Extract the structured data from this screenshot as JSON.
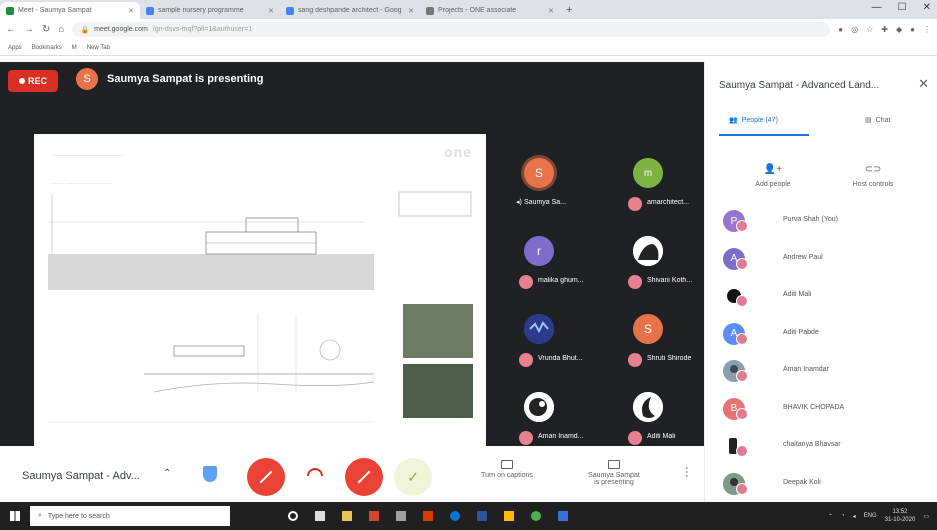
{
  "browser": {
    "tabs": [
      {
        "label": "Meet - Saumya Sampat",
        "active": true
      },
      {
        "label": "sample nursery programme",
        "active": false
      },
      {
        "label": "sang deshpande architect - Goog",
        "active": false
      },
      {
        "label": "Projects - ONE associate",
        "active": false
      }
    ],
    "new_tab_glyph": "+",
    "url_main": "meet.google.com",
    "url_rest": "/gn-dsvs-mqf?pli=1&authuser=1",
    "bookmarks": [
      "Apps",
      "Bookmarks",
      "M",
      "New Tab"
    ]
  },
  "meeting": {
    "rec_label": "REC",
    "presenter_initial": "S",
    "presenting_banner": "Saumya Sampat is presenting",
    "slide_logo": "one",
    "tiles": [
      {
        "name": "Saumya Sa...",
        "initial": "S",
        "color": "#e8734a",
        "speaking": true
      },
      {
        "name": "amarchitect...",
        "initial": "m",
        "color": "#7cb342",
        "speaking": false
      },
      {
        "name": "malika ghum...",
        "initial": "r",
        "color": "#7e6ccc",
        "speaking": false
      },
      {
        "name": "Shivani Koth...",
        "initial": "",
        "color": "#cfcfcf",
        "speaking": false
      },
      {
        "name": "Vrunda Bhut...",
        "initial": "",
        "color": "#3f51b5",
        "speaking": false
      },
      {
        "name": "Shruti Shirode",
        "initial": "S",
        "color": "#e8734a",
        "speaking": false
      },
      {
        "name": "Aman Inamd...",
        "initial": "",
        "color": "#cfcfcf",
        "speaking": false
      },
      {
        "name": "Aditi Mali",
        "initial": "",
        "color": "#cfcfcf",
        "speaking": false
      }
    ],
    "bar": {
      "meeting_title": "Saumya Sampat - Adv...",
      "captions_label": "Turn on captions",
      "presenting_label_1": "Saumya Sampat",
      "presenting_label_2": "is presenting"
    }
  },
  "panel": {
    "title": "Saumya Sampat - Advanced Land...",
    "tab_people": "People (47)",
    "tab_chat": "Chat",
    "add_people": "Add people",
    "host_controls": "Host controls",
    "participants": [
      {
        "name": "Purva Shah (You)",
        "initial": "P",
        "color": "#9575cd"
      },
      {
        "name": "Andrew Paul",
        "initial": "A",
        "color": "#7e6ccc"
      },
      {
        "name": "Aditi Mali",
        "initial": "",
        "color": "#ffffff"
      },
      {
        "name": "Aditi Pabde",
        "initial": "A",
        "color": "#5c8df6"
      },
      {
        "name": "Aman Inamdar",
        "initial": "",
        "color": "#b0bec5"
      },
      {
        "name": "BHAVIK CHOPADA",
        "initial": "B",
        "color": "#e57373"
      },
      {
        "name": "chaitanya Bhavsar",
        "initial": "",
        "color": "#ffffff"
      },
      {
        "name": "Deepak Koli",
        "initial": "",
        "color": "#90a4ae"
      }
    ]
  },
  "taskbar": {
    "search_placeholder": "Type here to search",
    "lang": "ENG",
    "time": "13:52",
    "date": "31-10-2020"
  }
}
